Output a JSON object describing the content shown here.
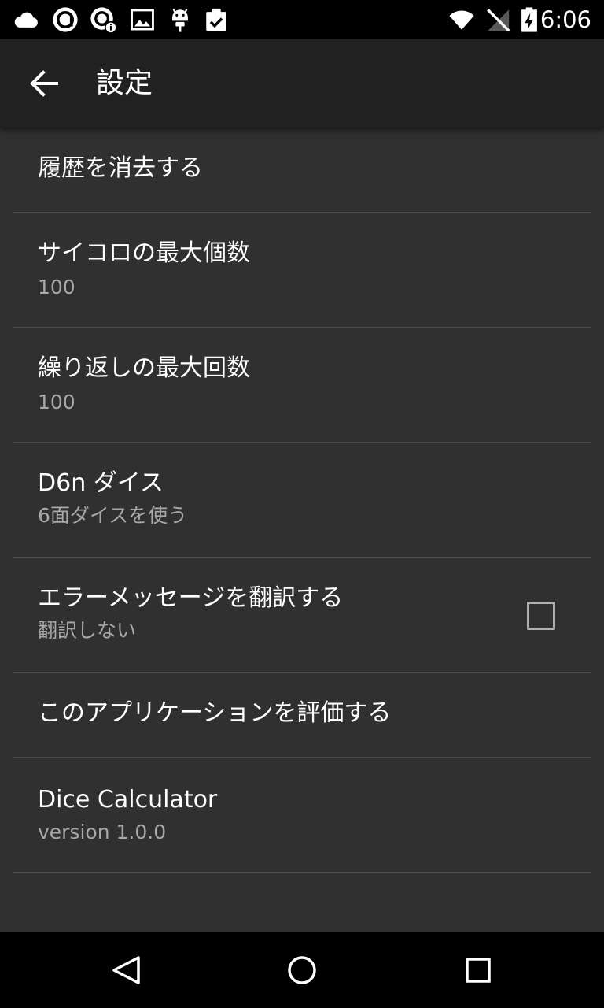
{
  "status_bar": {
    "time": "6:06",
    "left_icons": [
      "cloud-icon",
      "app-a-icon",
      "app-info-icon",
      "image-icon",
      "android-icon",
      "clipboard-check-icon"
    ],
    "right_icons": [
      "wifi-icon",
      "no-signal-icon",
      "battery-charging-icon"
    ]
  },
  "app_bar": {
    "title": "設定",
    "back_icon": "arrow-back-icon"
  },
  "preferences": [
    {
      "title": "履歴を消去する"
    },
    {
      "title": "サイコロの最大個数",
      "summary": "100"
    },
    {
      "title": "繰り返しの最大回数",
      "summary": "100"
    },
    {
      "title": "D6n ダイス",
      "summary": "6面ダイスを使う"
    },
    {
      "title": "エラーメッセージを翻訳する",
      "summary": "翻訳しない",
      "checked": false
    },
    {
      "title": "このアプリケーションを評価する"
    },
    {
      "title": "Dice Calculator",
      "summary": "version 1.0.0"
    }
  ],
  "nav_bar": {
    "icons": [
      "back-triangle-icon",
      "home-circle-icon",
      "recents-square-icon"
    ]
  },
  "colors": {
    "background": "#303030",
    "app_bar": "#212121",
    "divider": "#4a4a4a",
    "title_text": "#ffffff",
    "summary_text": "#a8a8a8"
  }
}
